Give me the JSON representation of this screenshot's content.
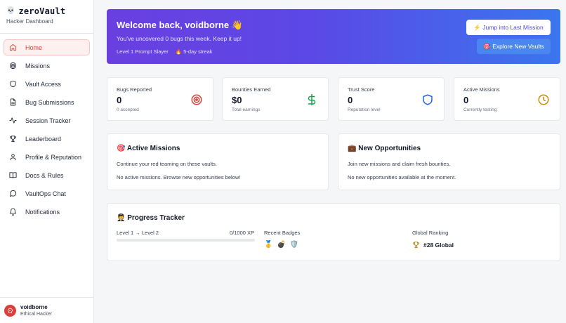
{
  "app": {
    "name": "zeroVault",
    "subtitle": "Hacker Dashboard",
    "logo_icon": "skull-icon"
  },
  "sidebar": {
    "items": [
      {
        "label": "Home",
        "icon": "home-icon",
        "active": true
      },
      {
        "label": "Missions",
        "icon": "target-icon",
        "active": false
      },
      {
        "label": "Vault Access",
        "icon": "shield-icon",
        "active": false
      },
      {
        "label": "Bug Submissions",
        "icon": "document-icon",
        "active": false
      },
      {
        "label": "Session Tracker",
        "icon": "activity-icon",
        "active": false
      },
      {
        "label": "Leaderboard",
        "icon": "trophy-icon",
        "active": false
      },
      {
        "label": "Profile & Reputation",
        "icon": "user-icon",
        "active": false
      },
      {
        "label": "Docs & Rules",
        "icon": "book-icon",
        "active": false
      },
      {
        "label": "VaultOps Chat",
        "icon": "chat-icon",
        "active": false
      },
      {
        "label": "Notifications",
        "icon": "bell-icon",
        "active": false
      }
    ],
    "active_color": "#d24a3a"
  },
  "user": {
    "name": "voidborne",
    "role": "Ethical Hacker"
  },
  "hero": {
    "title": "Welcome back, voidborne 👋",
    "subtitle": "You've uncovered 0 bugs this week. Keep it up!",
    "level": "Level 1 Prompt Slayer",
    "streak": "🔥 5-day streak",
    "primary_button": "⚡ Jump into Last Mission",
    "secondary_button": "🎯 Explore New Vaults"
  },
  "stats": [
    {
      "label": "Bugs Reported",
      "value": "0",
      "sub": "0 accepted",
      "icon": "target-icon",
      "color": "#dc3f3b"
    },
    {
      "label": "Bounties Earned",
      "value": "$0",
      "sub": "Total earnings",
      "icon": "dollar-icon",
      "color": "#16a34a"
    },
    {
      "label": "Trust Score",
      "value": "0",
      "sub": "Reputation level",
      "icon": "shield-icon",
      "color": "#2563eb"
    },
    {
      "label": "Active Missions",
      "value": "0",
      "sub": "Currently testing",
      "icon": "clock-icon",
      "color": "#ca8a04"
    }
  ],
  "active_missions": {
    "title": "🎯 Active Missions",
    "description": "Continue your red teaming on these vaults.",
    "empty": "No active missions. Browse new opportunities below!"
  },
  "opportunities": {
    "title": "💼 New Opportunities",
    "description": "Join new missions and claim fresh bounties.",
    "empty": "No new opportunities available at the moment."
  },
  "progress": {
    "title": "🧑‍✈️ Progress Tracker",
    "level_label": "Level 1 → Level 2",
    "xp": "0/1000 XP",
    "progress_fraction": 0,
    "badges_label": "Recent Badges",
    "badges": [
      "🥇",
      "💣",
      "🛡️"
    ],
    "ranking_label": "Global Ranking",
    "ranking": "#28 Global"
  }
}
